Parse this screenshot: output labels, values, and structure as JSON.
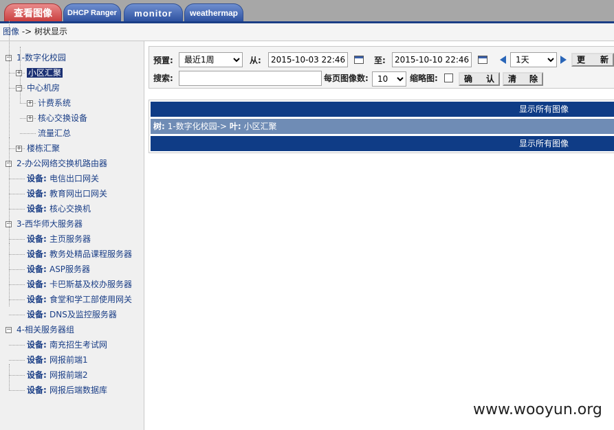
{
  "tabs": [
    {
      "label": "查看图像",
      "active": true
    },
    {
      "label": "DHCP Ranger",
      "active": false
    },
    {
      "label": "monitor",
      "active": false
    },
    {
      "label": "weathermap",
      "active": false
    }
  ],
  "breadcrumb": {
    "link": "图像",
    "rest": " -> 树状显示"
  },
  "tree": {
    "device_prefix": "设备:",
    "nodes": [
      {
        "label": "1-数字化校园",
        "toggle": "-"
      },
      {
        "label": "小区汇聚",
        "toggle": "+",
        "selected": true
      },
      {
        "label": "中心机房",
        "toggle": "-"
      },
      {
        "label": "计费系统",
        "toggle": "+"
      },
      {
        "label": "核心交换设备",
        "toggle": "+"
      },
      {
        "label": "流量汇总",
        "toggle": ""
      },
      {
        "label": "楼栋汇聚",
        "toggle": "+"
      },
      {
        "label": "2-办公网络交换机路由器",
        "toggle": "-"
      },
      {
        "label": "电信出口网关",
        "device": true
      },
      {
        "label": "教育网出口网关",
        "device": true
      },
      {
        "label": "核心交换机",
        "device": true
      },
      {
        "label": "3-西华师大服务器",
        "toggle": "-"
      },
      {
        "label": "主页服务器",
        "device": true
      },
      {
        "label": "教务处精品课程服务器",
        "device": true
      },
      {
        "label": "ASP服务器",
        "device": true
      },
      {
        "label": "卡巴斯基及校办服务器",
        "device": true
      },
      {
        "label": "食堂和学工部使用网关",
        "device": true
      },
      {
        "label": "DNS及监控服务器",
        "device": true
      },
      {
        "label": "4-相关服务器组",
        "toggle": "-"
      },
      {
        "label": "南充招生考试网",
        "device": true
      },
      {
        "label": "网报前端1",
        "device": true
      },
      {
        "label": "网报前端2",
        "device": true
      },
      {
        "label": "网报后端数据库",
        "device": true
      }
    ]
  },
  "controls": {
    "preset_label": "预置:",
    "preset_value": "最近1周",
    "from_label": "从:",
    "from_value": "2015-10-03 22:46",
    "to_label": "至:",
    "to_value": "2015-10-10 22:46",
    "span_value": "1天",
    "refresh_button": [
      "更",
      "新"
    ],
    "search_label": "搜索:",
    "search_value": "",
    "per_page_label": "每页图像数:",
    "per_page_value": "10",
    "thumbnail_label": "缩略图:",
    "confirm_button": [
      "确",
      "认"
    ],
    "clear_button": [
      "清",
      "除"
    ]
  },
  "result": {
    "show_all_top": "显示所有图像",
    "path_prefix": "树:",
    "path_tree": "1-数字化校园->",
    "path_leaf_prefix": "叶:",
    "path_leaf": "小区汇聚",
    "show_all_bottom": "显示所有图像"
  },
  "watermark": "www.wooyun.org"
}
